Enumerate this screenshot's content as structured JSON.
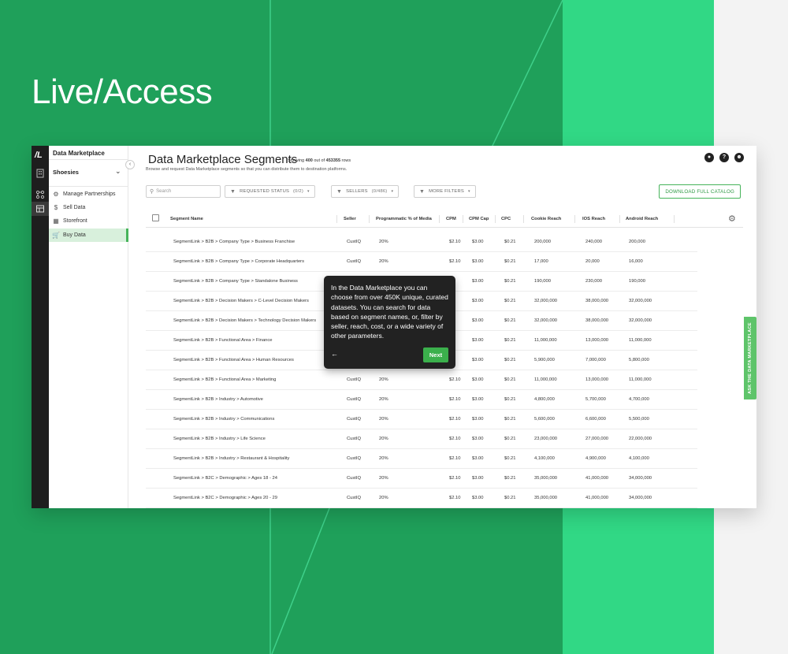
{
  "hero": {
    "title": "Live/Access"
  },
  "app": {
    "logo": "/L",
    "sidenav": {
      "app_name": "Data Marketplace",
      "org": "Shoesies",
      "items": [
        {
          "label": "Manage Partnerships",
          "icon": "gear-icon"
        },
        {
          "label": "Sell Data",
          "icon": "dollar-icon"
        },
        {
          "label": "Storefront",
          "icon": "store-icon"
        },
        {
          "label": "Buy Data",
          "icon": "cart-icon"
        }
      ]
    },
    "header": {
      "title": "Data Marketplace Segments",
      "showing_prefix": "Showing ",
      "showing_count": "400",
      "showing_mid": " out of ",
      "showing_total": "453355",
      "showing_suffix": " rows",
      "subtitle": "Browse and request Data Marketplace segments so that you can distribute them to destination platforms."
    },
    "toolbar": {
      "search_placeholder": "Search",
      "filter_status": "REQUESTED STATUS",
      "filter_status_count": "(0/2)",
      "filter_sellers": "SELLERS",
      "filter_sellers_count": "(0/486)",
      "filter_more": "MORE FILTERS",
      "download": "DOWNLOAD FULL CATALOG"
    },
    "table": {
      "headers": [
        "Segment Name",
        "Seller",
        "Programmatic % of Media",
        "CPM",
        "CPM Cap",
        "CPC",
        "Cookie Reach",
        "IOS Reach",
        "Android Reach"
      ],
      "rows": [
        [
          "SegmentLink > B2B > Company Type > Business Franchise",
          "CustIQ",
          "20%",
          "$2.10",
          "$3.00",
          "$0.21",
          "200,000",
          "240,000",
          "200,000"
        ],
        [
          "SegmentLink > B2B > Company Type > Corporate Headquarters",
          "CustIQ",
          "20%",
          "$2.10",
          "$3.00",
          "$0.21",
          "17,000",
          "20,000",
          "16,000"
        ],
        [
          "SegmentLink > B2B > Company Type > Standalone Business",
          "",
          "",
          "",
          "$3.00",
          "$0.21",
          "190,000",
          "230,000",
          "190,000"
        ],
        [
          "SegmentLink > B2B > Decision Makers > C-Level Decision Makers",
          "",
          "",
          "",
          "$3.00",
          "$0.21",
          "32,000,000",
          "38,000,000",
          "32,000,000"
        ],
        [
          "SegmentLink > B2B > Decision Makers > Technology Decision Makers",
          "",
          "",
          "",
          "$3.00",
          "$0.21",
          "32,000,000",
          "38,000,000",
          "32,000,000"
        ],
        [
          "SegmentLink > B2B > Functional Area > Finance",
          "",
          "",
          "",
          "$3.00",
          "$0.21",
          "11,000,000",
          "13,000,000",
          "11,000,000"
        ],
        [
          "SegmentLink > B2B > Functional Area > Human Resources",
          "",
          "",
          "",
          "$3.00",
          "$0.21",
          "5,900,000",
          "7,000,000",
          "5,800,000"
        ],
        [
          "SegmentLink > B2B > Functional Area > Marketing",
          "CustIQ",
          "20%",
          "$2.10",
          "$3.00",
          "$0.21",
          "11,000,000",
          "13,000,000",
          "11,000,000"
        ],
        [
          "SegmentLink > B2B > Industry > Automotive",
          "CustIQ",
          "20%",
          "$2.10",
          "$3.00",
          "$0.21",
          "4,800,000",
          "5,700,000",
          "4,700,000"
        ],
        [
          "SegmentLink > B2B > Industry > Communications",
          "CustIQ",
          "20%",
          "$2.10",
          "$3.00",
          "$0.21",
          "5,600,000",
          "6,600,000",
          "5,500,000"
        ],
        [
          "SegmentLink > B2B > Industry > Life Science",
          "CustIQ",
          "20%",
          "$2.10",
          "$3.00",
          "$0.21",
          "23,000,000",
          "27,000,000",
          "22,000,000"
        ],
        [
          "SegmentLink > B2B > Industry > Restaurant & Hospitality",
          "CustIQ",
          "20%",
          "$2.10",
          "$3.00",
          "$0.21",
          "4,100,000",
          "4,900,000",
          "4,100,000"
        ],
        [
          "SegmentLink > B2C > Demographic > Ages 18 - 24",
          "CustIQ",
          "20%",
          "$2.10",
          "$3.00",
          "$0.21",
          "35,000,000",
          "41,000,000",
          "34,000,000"
        ],
        [
          "SegmentLink > B2C > Demographic > Ages 20 - 29",
          "CustIQ",
          "20%",
          "$2.10",
          "$3.00",
          "$0.21",
          "35,000,000",
          "41,000,000",
          "34,000,000"
        ]
      ]
    },
    "tooltip": {
      "text": "In the Data Marketplace you can choose from over 450K unique, curated datasets. You can search for data based on segment names, or, filter by seller, reach, cost, or a wide variety of other parameters.",
      "back": "←",
      "next": "Next"
    },
    "ask_tab": "ASK THE DATA MARKETPLACE"
  },
  "colors": {
    "brand_green": "#1fa05a",
    "accent_green": "#31d885",
    "button_green": "#3bb04c"
  }
}
